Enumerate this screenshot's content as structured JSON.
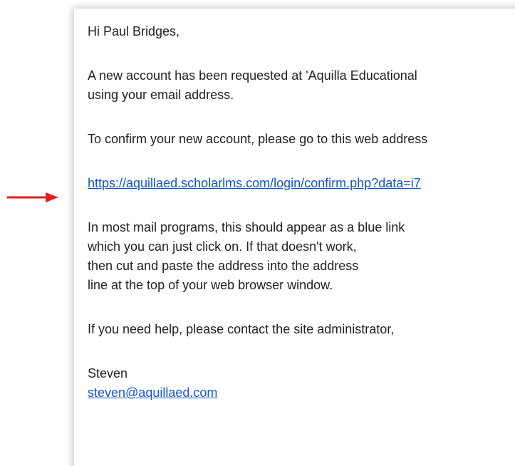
{
  "email": {
    "greeting": "Hi Paul Bridges,",
    "paragraph1": {
      "line1": "A new account has been requested at 'Aquilla Educational",
      "line2": "using your email address."
    },
    "paragraph2": "To confirm your new account, please go to this web address",
    "confirm_link": "https://aquillaed.scholarlms.com/login/confirm.php?data=i7",
    "paragraph3": {
      "line1": "In most mail programs, this should appear as a blue link",
      "line2": "which you can just click on. If that doesn't work,",
      "line3": "then cut and paste the address into the address",
      "line4": "line at the top of your web browser window."
    },
    "paragraph4": "If you need help, please contact the site administrator,",
    "signature": {
      "name": "Steven",
      "email_link": "steven@aquillaed.com"
    }
  },
  "colors": {
    "link": "#1155cc",
    "text": "#222222",
    "arrow": "#e0201f"
  },
  "icons": {
    "annotation": "red-arrow-icon"
  }
}
